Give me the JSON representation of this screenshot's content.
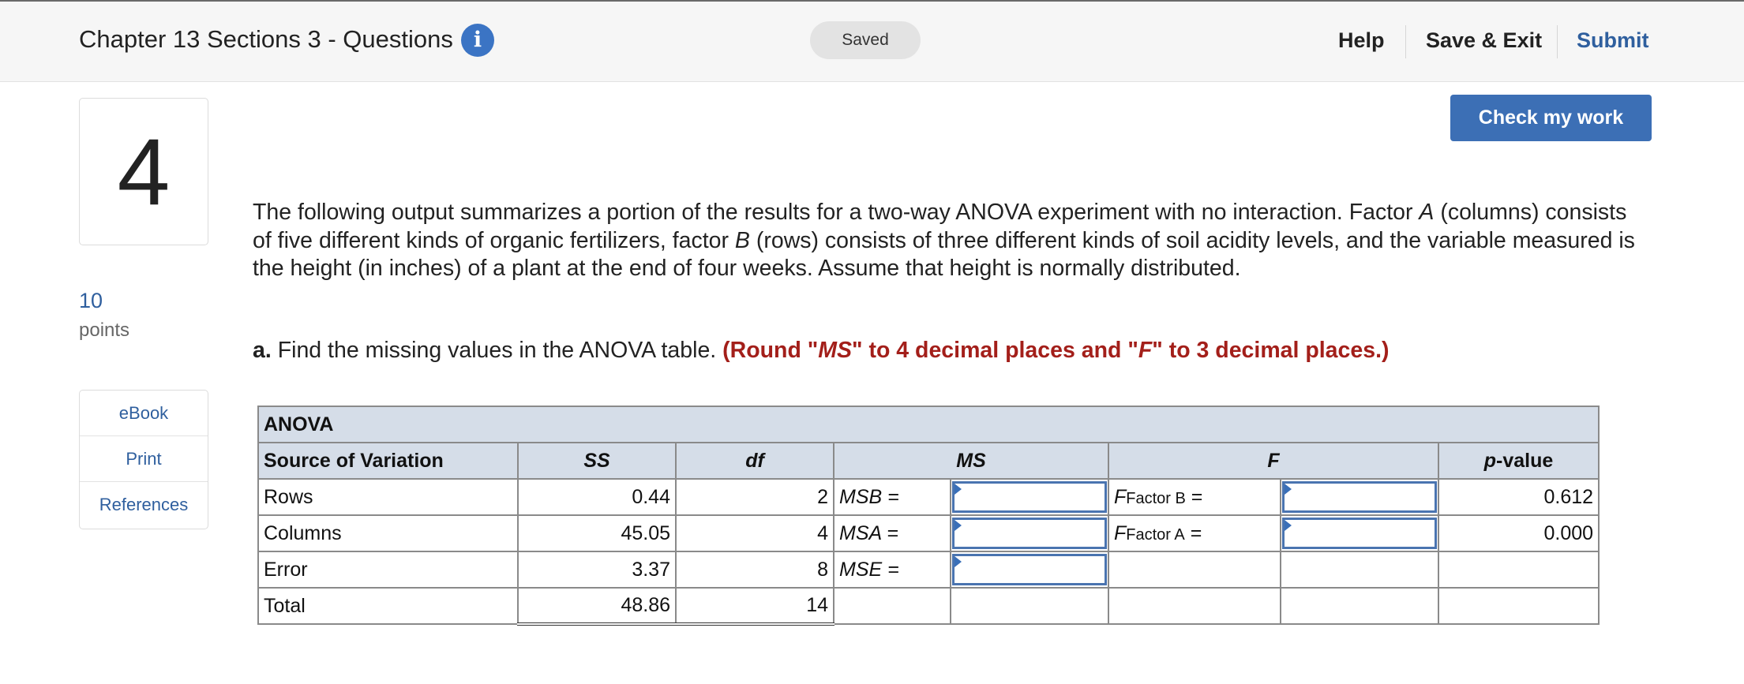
{
  "header": {
    "title": "Chapter 13 Sections 3 - Questions",
    "info_icon": "info-icon",
    "saved_label": "Saved",
    "help_label": "Help",
    "save_exit_label": "Save & Exit",
    "submit_label": "Submit"
  },
  "check_button_label": "Check my work",
  "question": {
    "number": "4",
    "points_value": "10",
    "points_label": "points",
    "text_part1": "The following output summarizes a portion of the results for a two-way ANOVA experiment with no interaction. Factor ",
    "factor_a": "A",
    "text_part2": " (columns) consists of five different kinds of organic fertilizers, factor ",
    "factor_b": "B",
    "text_part3": " (rows) consists of three different kinds of soil acidity levels, and the variable measured is the height (in inches) of a plant at the end of four weeks. Assume that height is normally distributed.",
    "part_a_label": "a.",
    "part_a_text": " Find the missing values in the ANOVA table. ",
    "part_a_instruction": "(Round \"MS\" to 4 decimal places and \"F\" to 3 decimal places.)"
  },
  "side_links": [
    "eBook",
    "Print",
    "References"
  ],
  "anova": {
    "title": "ANOVA",
    "headers": [
      "Source of Variation",
      "SS",
      "df",
      "MS",
      "F",
      "p-value"
    ],
    "rows": [
      {
        "source": "Rows",
        "ss": "0.44",
        "df": "2",
        "ms_label": "MSB =",
        "f_label": "F",
        "f_sub": "Factor B",
        "f_eq": " =",
        "p": "0.612"
      },
      {
        "source": "Columns",
        "ss": "45.05",
        "df": "4",
        "ms_label": "MSA =",
        "f_label": "F",
        "f_sub": "Factor A",
        "f_eq": " =",
        "p": "0.000"
      },
      {
        "source": "Error",
        "ss": "3.37",
        "df": "8",
        "ms_label": "MSE ="
      },
      {
        "source": "Total",
        "ss": "48.86",
        "df": "14"
      }
    ]
  },
  "colors": {
    "accent": "#3c6fb5",
    "link": "#2f5f9e",
    "instruction_red": "#a31f1a",
    "table_header_bg": "#d5dde8"
  }
}
